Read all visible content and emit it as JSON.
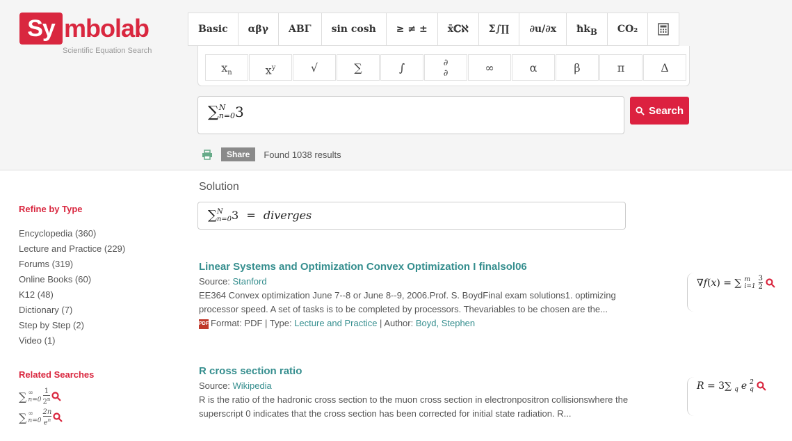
{
  "logo": {
    "prefix": "Sy",
    "rest": "mbolab",
    "subtitle": "Scientific Equation Search"
  },
  "keyboard": {
    "row1": [
      "Basic",
      "αβγ",
      "ΑΒΓ",
      "sin cosh",
      "≥ ≠ ±",
      "x̄ℂℵ",
      "Σ∫∏",
      "∂u/∂x",
      "ħk_B",
      "CO₂",
      "calculator-icon"
    ],
    "row2": [
      "x_n",
      "x^y",
      "√",
      "∑",
      "∫",
      "∂/∂",
      "∞",
      "α",
      "β",
      "π",
      "Δ"
    ]
  },
  "search": {
    "query": "∑_{n=0}^{N} 3",
    "button_label": "Search"
  },
  "tools": {
    "share_label": "Share",
    "results_text": "Found 1038 results"
  },
  "sidebar": {
    "refine_title": "Refine by Type",
    "types": [
      "Encyclopedia (360)",
      "Lecture and Practice (229)",
      "Forums (319)",
      "Online Books (60)",
      "K12 (48)",
      "Dictionary (7)",
      "Step by Step (2)",
      "Video (1)"
    ],
    "related_title": "Related Searches",
    "related": [
      "∑_{n=0}^{∞} 1/2^n",
      "∑_{n=0}^{∞} 2n/e^n"
    ]
  },
  "solution": {
    "label": "Solution",
    "lhs": "∑_{n=0}^{N} 3",
    "eq": "=",
    "rhs": "diverges"
  },
  "results": [
    {
      "title": "Linear Systems and Optimization Convex Optimization I finalsol06",
      "source_label": "Source:",
      "source": "Stanford",
      "snippet": "EE364 Convex optimization June 7--8 or June 8--9, 2006.Prof. S. BoydFinal exam solutions1. optimizing processor speed. A set of tasks is to be completed by processors. Thevariables to be chosen are the...",
      "format_label": "Format: PDF | Type:",
      "type": "Lecture and Practice",
      "author_label": "| Author:",
      "author": "Boyd, Stephen",
      "formula": "∇f(x) = ∑_{i=1}^{m} 3/2"
    },
    {
      "title": "R cross section ratio",
      "source_label": "Source:",
      "source": "Wikipedia",
      "snippet": "R is the ratio of the hadronic cross section to the muon cross section in electronpositron collisionswhere the superscript 0 indicates that the cross section has been corrected for initial state radiation. R...",
      "formula": "R = 3∑_q e_q^2"
    }
  ],
  "colors": {
    "brand": "#d9273f",
    "link": "#358e8e"
  }
}
